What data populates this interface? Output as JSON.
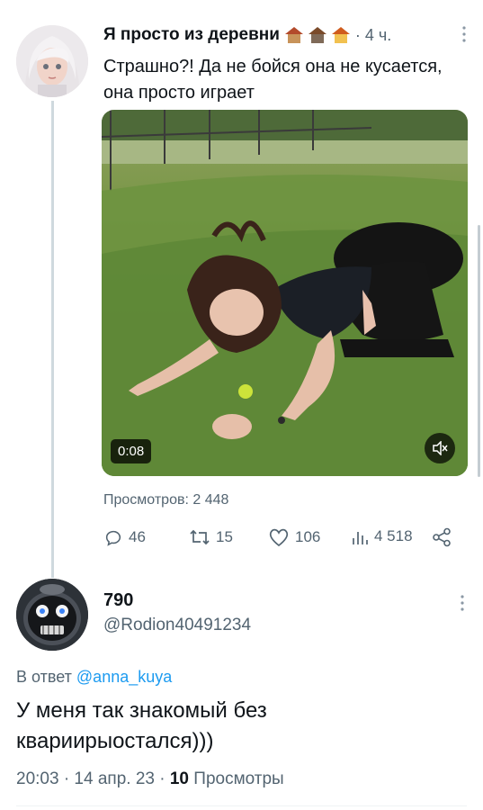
{
  "tweet1": {
    "author_name": "Я просто из деревни",
    "time": "· 4 ч.",
    "text": "Страшно?! Да не бойся она не кусается, она просто играет",
    "video_duration": "0:08",
    "views": "Просмотров: 2 448",
    "stats": {
      "replies": "46",
      "retweets": "15",
      "likes": "106",
      "views": "4 518"
    },
    "icons": {
      "house_icons": [
        "hut-icon",
        "house-icon",
        "home-icon"
      ],
      "mute": "volume-mute-icon"
    }
  },
  "tweet2": {
    "author_name": "790",
    "handle": "@Rodion40491234",
    "reply_prefix": "В ответ",
    "reply_handle": "@anna_kuya",
    "text": "У меня так знакомый без квариирыостался)))",
    "time": "20:03 · 14 апр. 23 ·",
    "views_count": "10",
    "views_label": "Просмотры"
  },
  "colors": {
    "accent": "#1d9bf0",
    "muted": "#536471",
    "thread_line": "#cfd9de"
  }
}
